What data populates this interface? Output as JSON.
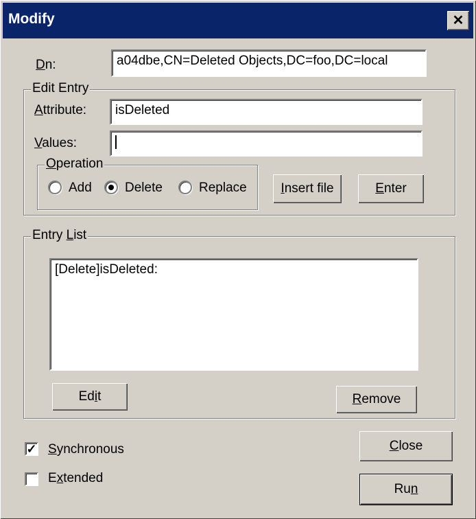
{
  "window": {
    "title": "Modify",
    "close_glyph": "✕",
    "close_icon": "close-icon"
  },
  "dn": {
    "label_u": "D",
    "label_rest": "n:",
    "value": "a04dbe,CN=Deleted Objects,DC=foo,DC=local"
  },
  "edit_entry": {
    "group_label": "Edit Entry",
    "attribute_label_u": "A",
    "attribute_label_rest": "ttribute:",
    "attribute_value": "isDeleted",
    "values_label_u": "V",
    "values_label_rest": "alues:",
    "values_value": "",
    "operation": {
      "group_label_u": "O",
      "group_label_rest": "peration",
      "options": [
        {
          "label": "Add",
          "selected": false
        },
        {
          "label": "Delete",
          "selected": true
        },
        {
          "label": "Replace",
          "selected": false
        }
      ]
    },
    "insert_file_u": "I",
    "insert_file_rest": "nsert file",
    "enter_u": "E",
    "enter_rest": "nter"
  },
  "entry_list": {
    "group_label_pre": "Entry ",
    "group_label_u": "L",
    "group_label_rest": "ist",
    "items": [
      "[Delete]isDeleted:"
    ],
    "edit_pre": "Ed",
    "edit_u": "i",
    "edit_rest": "t",
    "remove_u": "R",
    "remove_rest": "emove"
  },
  "options": {
    "synchronous": {
      "u": "S",
      "rest": "ynchronous",
      "checked": true
    },
    "extended": {
      "pre": "E",
      "u": "x",
      "rest": "tended",
      "checked": false
    }
  },
  "buttons": {
    "close_u": "C",
    "close_rest": "lose",
    "run_pre": "Ru",
    "run_u": "n",
    "run_rest": ""
  },
  "check_glyph": "✓"
}
